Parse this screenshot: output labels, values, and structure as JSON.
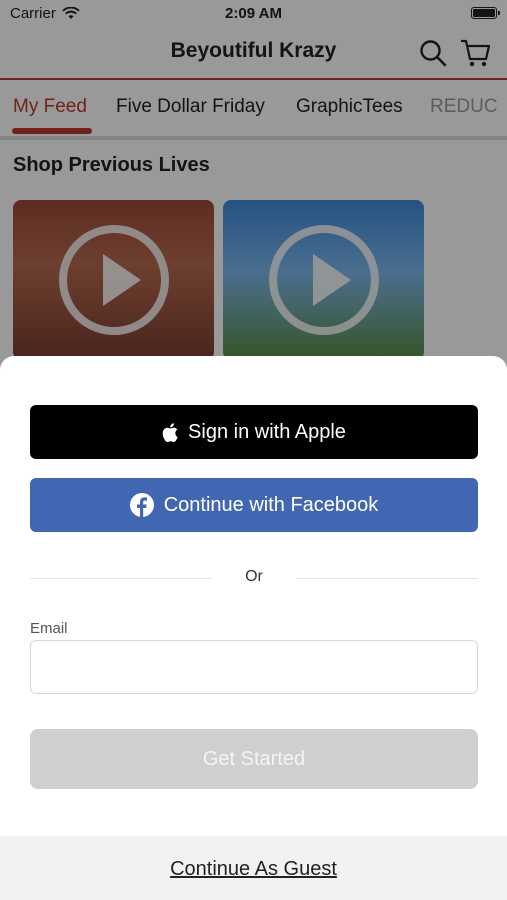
{
  "status_bar": {
    "carrier": "Carrier",
    "time": "2:09 AM"
  },
  "header": {
    "title": "Beyoutiful Krazy"
  },
  "tabs": [
    {
      "label": "My Feed"
    },
    {
      "label": "Five Dollar Friday"
    },
    {
      "label": "GraphicTees"
    },
    {
      "label": "REDUC"
    }
  ],
  "section": {
    "title": "Shop Previous Lives"
  },
  "sheet": {
    "apple_label": "Sign in with Apple",
    "facebook_label": "Continue with Facebook",
    "or_text": "Or",
    "email_label": "Email",
    "email_value": "",
    "get_started_label": "Get Started",
    "guest_label": "Continue As Guest"
  },
  "colors": {
    "accent": "#c0392b",
    "facebook": "#4267b2",
    "apple": "#000000",
    "disabled": "#cfcfcf"
  }
}
